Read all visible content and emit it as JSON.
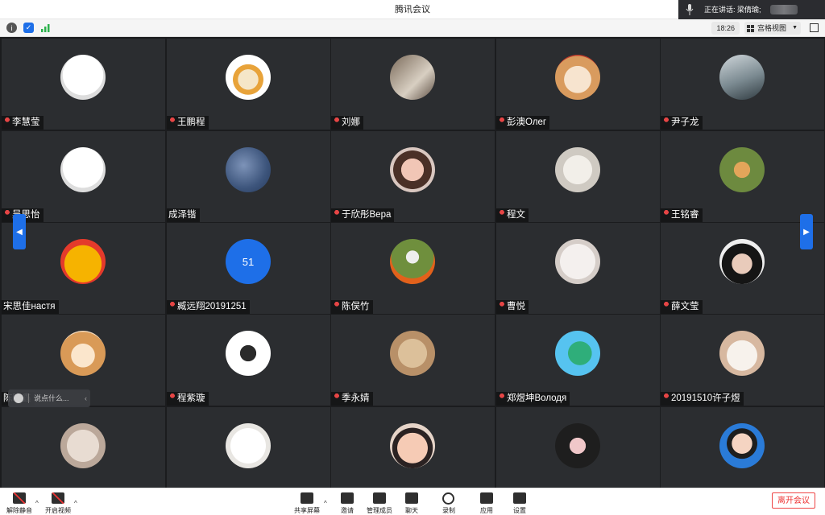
{
  "window": {
    "title": "腾讯会议"
  },
  "speaking": {
    "label": "正在讲话: 梁倩瑜;"
  },
  "toolbar": {
    "time": "18:26",
    "view_label": "宫格视图"
  },
  "chat": {
    "placeholder": "说点什么..."
  },
  "bottom": {
    "buttons": [
      {
        "name": "mute-button",
        "label": "解除静音"
      },
      {
        "name": "video-button",
        "label": "开启视频"
      },
      {
        "name": "share-screen-button",
        "label": "共享屏幕"
      },
      {
        "name": "invite-button",
        "label": "邀请"
      },
      {
        "name": "members-button",
        "label": "管理成员"
      },
      {
        "name": "chat-button",
        "label": "聊天"
      },
      {
        "name": "record-button",
        "label": "录制"
      },
      {
        "name": "apps-button",
        "label": "应用"
      },
      {
        "name": "settings-button",
        "label": "设置"
      }
    ],
    "leave": "离开会议"
  },
  "participants": [
    {
      "name": "李慧莹",
      "avatar": "bw-sketch",
      "muted": true
    },
    {
      "name": "王鹏程",
      "avatar": "cartoon-drum",
      "muted": true
    },
    {
      "name": "刘娜",
      "avatar": "desk-photo",
      "muted": true
    },
    {
      "name": "彭澳Олег",
      "avatar": "cat-orange",
      "muted": true
    },
    {
      "name": "尹子龙",
      "avatar": "person-photo",
      "muted": true
    },
    {
      "name": "吴思怡",
      "avatar": "bw-sketch",
      "muted": true
    },
    {
      "name": "成泽锴",
      "avatar": "earth-blue",
      "muted": false
    },
    {
      "name": "于欣彤Вера",
      "avatar": "girl-photo",
      "muted": true
    },
    {
      "name": "程文",
      "avatar": "dog-white",
      "muted": true
    },
    {
      "name": "王铭睿",
      "avatar": "dog-grass",
      "muted": true
    },
    {
      "name": "宋思佳настя",
      "avatar": "pooh",
      "muted": false
    },
    {
      "name": "臧远翔20191251",
      "avatar": "number",
      "avatar_text": "51",
      "muted": true
    },
    {
      "name": "陈俣竹",
      "avatar": "pumpkin-dog",
      "muted": true
    },
    {
      "name": "曹悦",
      "avatar": "cat-white",
      "muted": true
    },
    {
      "name": "薛文莹",
      "avatar": "girl-dark",
      "muted": true
    },
    {
      "name": "陈晔鑫",
      "avatar": "cat-orange2",
      "muted": false
    },
    {
      "name": "程紫璇",
      "avatar": "cartoon-girl",
      "muted": true
    },
    {
      "name": "季永婧",
      "avatar": "cat-sleep",
      "muted": true
    },
    {
      "name": "郑煜坤Володя",
      "avatar": "dino",
      "muted": true
    },
    {
      "name": "20191510许子煜",
      "avatar": "cat-cream",
      "muted": true
    },
    {
      "name": "",
      "avatar": "cat-pale",
      "muted": false
    },
    {
      "name": "",
      "avatar": "samoyed",
      "muted": false
    },
    {
      "name": "",
      "avatar": "child-face",
      "muted": false
    },
    {
      "name": "",
      "avatar": "child-stand",
      "muted": false
    },
    {
      "name": "",
      "avatar": "woman-portrait",
      "muted": false
    }
  ],
  "colors": {
    "accent": "#1e6fe8",
    "stage_bg": "#1b1c1e",
    "tile_bg": "#2b2d30",
    "leave": "#e33333"
  }
}
